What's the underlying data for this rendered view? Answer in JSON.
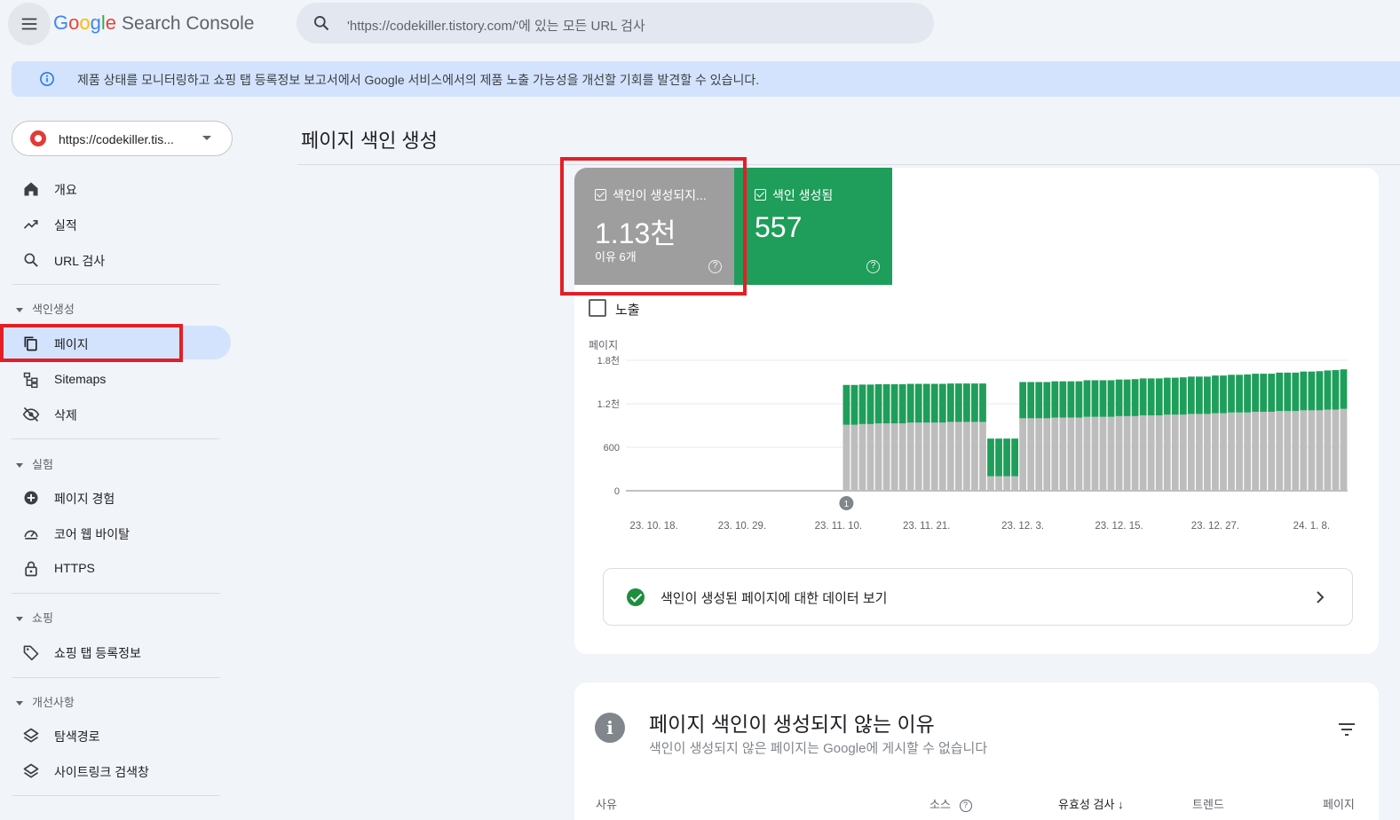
{
  "header": {
    "menu_icon": "hamburger-icon",
    "logo_g": [
      "G",
      "o",
      "o",
      "g",
      "l",
      "e"
    ],
    "logo_product": "Search Console",
    "search_placeholder": "'https://codekiller.tistory.com/'에 있는 모든 URL 검사"
  },
  "banner": {
    "text": "제품 상태를 모니터링하고 쇼핑 탭 등록정보 보고서에서 Google 서비스에서의 제품 노출 가능성을 개선할 기회를 발견할 수 있습니다."
  },
  "sidebar": {
    "property": "https://codekiller.tis...",
    "items": [
      {
        "label": "개요",
        "icon": "home-icon"
      },
      {
        "label": "실적",
        "icon": "trending-up-icon"
      },
      {
        "label": "URL 검사",
        "icon": "search-icon"
      }
    ],
    "sections": [
      {
        "title": "색인생성",
        "items": [
          {
            "label": "페이지",
            "icon": "pages-icon",
            "active": true
          },
          {
            "label": "Sitemaps",
            "icon": "sitemap-icon"
          },
          {
            "label": "삭제",
            "icon": "visibility-off-icon"
          }
        ]
      },
      {
        "title": "실험",
        "items": [
          {
            "label": "페이지 경험",
            "icon": "add-circle-icon"
          },
          {
            "label": "코어 웹 바이탈",
            "icon": "speed-icon"
          },
          {
            "label": "HTTPS",
            "icon": "lock-icon"
          }
        ]
      },
      {
        "title": "쇼핑",
        "items": [
          {
            "label": "쇼핑 탭 등록정보",
            "icon": "tag-icon"
          }
        ]
      },
      {
        "title": "개선사항",
        "items": [
          {
            "label": "탐색경로",
            "icon": "layers-icon"
          },
          {
            "label": "사이트링크 검색창",
            "icon": "layers-icon"
          }
        ]
      }
    ]
  },
  "main": {
    "page_title": "페이지 색인 생성",
    "tiles": [
      {
        "label": "색인이 생성되지...",
        "value": "1.13천",
        "sub": "이유 6개",
        "color": "#9e9e9e"
      },
      {
        "label": "색인 생성됨",
        "value": "557",
        "sub": "",
        "color": "#1e9e5a"
      }
    ],
    "impressions_label": "노출",
    "data_link": "색인이 생성된 페이지에 대한 데이터 보기",
    "reasons": {
      "title": "페이지 색인이 생성되지 않는 이유",
      "subtitle": "색인이 생성되지 않은 페이지는 Google에 게시할 수 없습니다",
      "columns": [
        "사유",
        "소스",
        "유효성 검사",
        "트렌드",
        "페이지"
      ]
    }
  },
  "chart_data": {
    "type": "bar",
    "stacked": true,
    "ylabel": "페이지",
    "ytick_labels": [
      "0",
      "600",
      "1.2천",
      "1.8천"
    ],
    "yticks": [
      0,
      600,
      1200,
      1800
    ],
    "ylim": [
      0,
      1800
    ],
    "xtick_labels": [
      "23. 10. 18.",
      "23. 10. 29.",
      "23. 11. 10.",
      "23. 11. 21.",
      "23. 12. 3.",
      "23. 12. 15.",
      "23. 12. 27.",
      "24. 1. 8."
    ],
    "xtick_index": [
      3,
      14,
      26,
      37,
      49,
      61,
      73,
      85
    ],
    "annotation": {
      "label": "1",
      "index": 27
    },
    "series": [
      {
        "name": "색인이 생성되지 않음",
        "color": "#bdbdbd",
        "values": [
          0,
          0,
          0,
          0,
          0,
          0,
          0,
          0,
          0,
          0,
          0,
          0,
          0,
          0,
          0,
          0,
          0,
          0,
          0,
          0,
          0,
          0,
          0,
          0,
          0,
          0,
          0,
          910,
          910,
          920,
          920,
          930,
          930,
          930,
          930,
          940,
          940,
          940,
          940,
          940,
          950,
          950,
          950,
          950,
          950,
          200,
          200,
          200,
          200,
          1000,
          1000,
          1000,
          1000,
          1010,
          1010,
          1010,
          1010,
          1020,
          1020,
          1020,
          1020,
          1030,
          1030,
          1030,
          1040,
          1040,
          1040,
          1050,
          1050,
          1050,
          1060,
          1060,
          1060,
          1070,
          1070,
          1080,
          1080,
          1080,
          1090,
          1090,
          1090,
          1100,
          1100,
          1100,
          1110,
          1110,
          1110,
          1120,
          1120,
          1130
        ]
      },
      {
        "name": "색인 생성됨",
        "color": "#1e9e5a",
        "values": [
          0,
          0,
          0,
          0,
          0,
          0,
          0,
          0,
          0,
          0,
          0,
          0,
          0,
          0,
          0,
          0,
          0,
          0,
          0,
          0,
          0,
          0,
          0,
          0,
          0,
          0,
          0,
          550,
          550,
          545,
          545,
          540,
          540,
          540,
          540,
          535,
          535,
          535,
          535,
          535,
          530,
          530,
          530,
          530,
          530,
          520,
          520,
          520,
          520,
          500,
          500,
          500,
          500,
          500,
          500,
          500,
          500,
          505,
          505,
          505,
          505,
          505,
          505,
          510,
          510,
          510,
          510,
          510,
          510,
          515,
          515,
          515,
          515,
          520,
          520,
          520,
          520,
          525,
          525,
          525,
          525,
          530,
          530,
          530,
          535,
          535,
          540,
          540,
          545,
          545
        ]
      }
    ]
  }
}
